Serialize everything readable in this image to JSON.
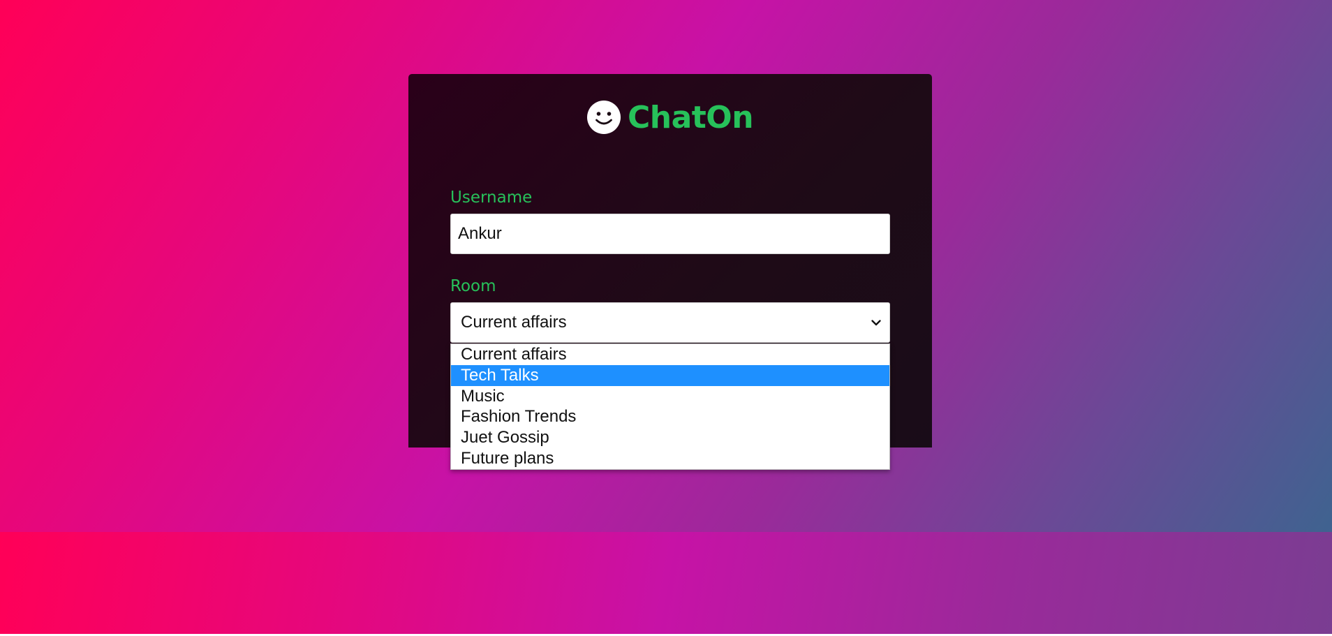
{
  "app": {
    "brand_title": "ChatOn",
    "brand_icon": "smiley-icon"
  },
  "form": {
    "username_label": "Username",
    "username_value": "Ankur",
    "room_label": "Room",
    "room_selected": "Current affairs",
    "room_options": [
      "Current affairs",
      "Tech Talks",
      "Music",
      "Fashion Trends",
      "Juet Gossip",
      "Future plans"
    ],
    "highlighted_option": "Tech Talks"
  },
  "colors": {
    "accent_green": "#27c15a",
    "card_background": "#1e0b17",
    "highlight_blue": "#1e90ff"
  }
}
